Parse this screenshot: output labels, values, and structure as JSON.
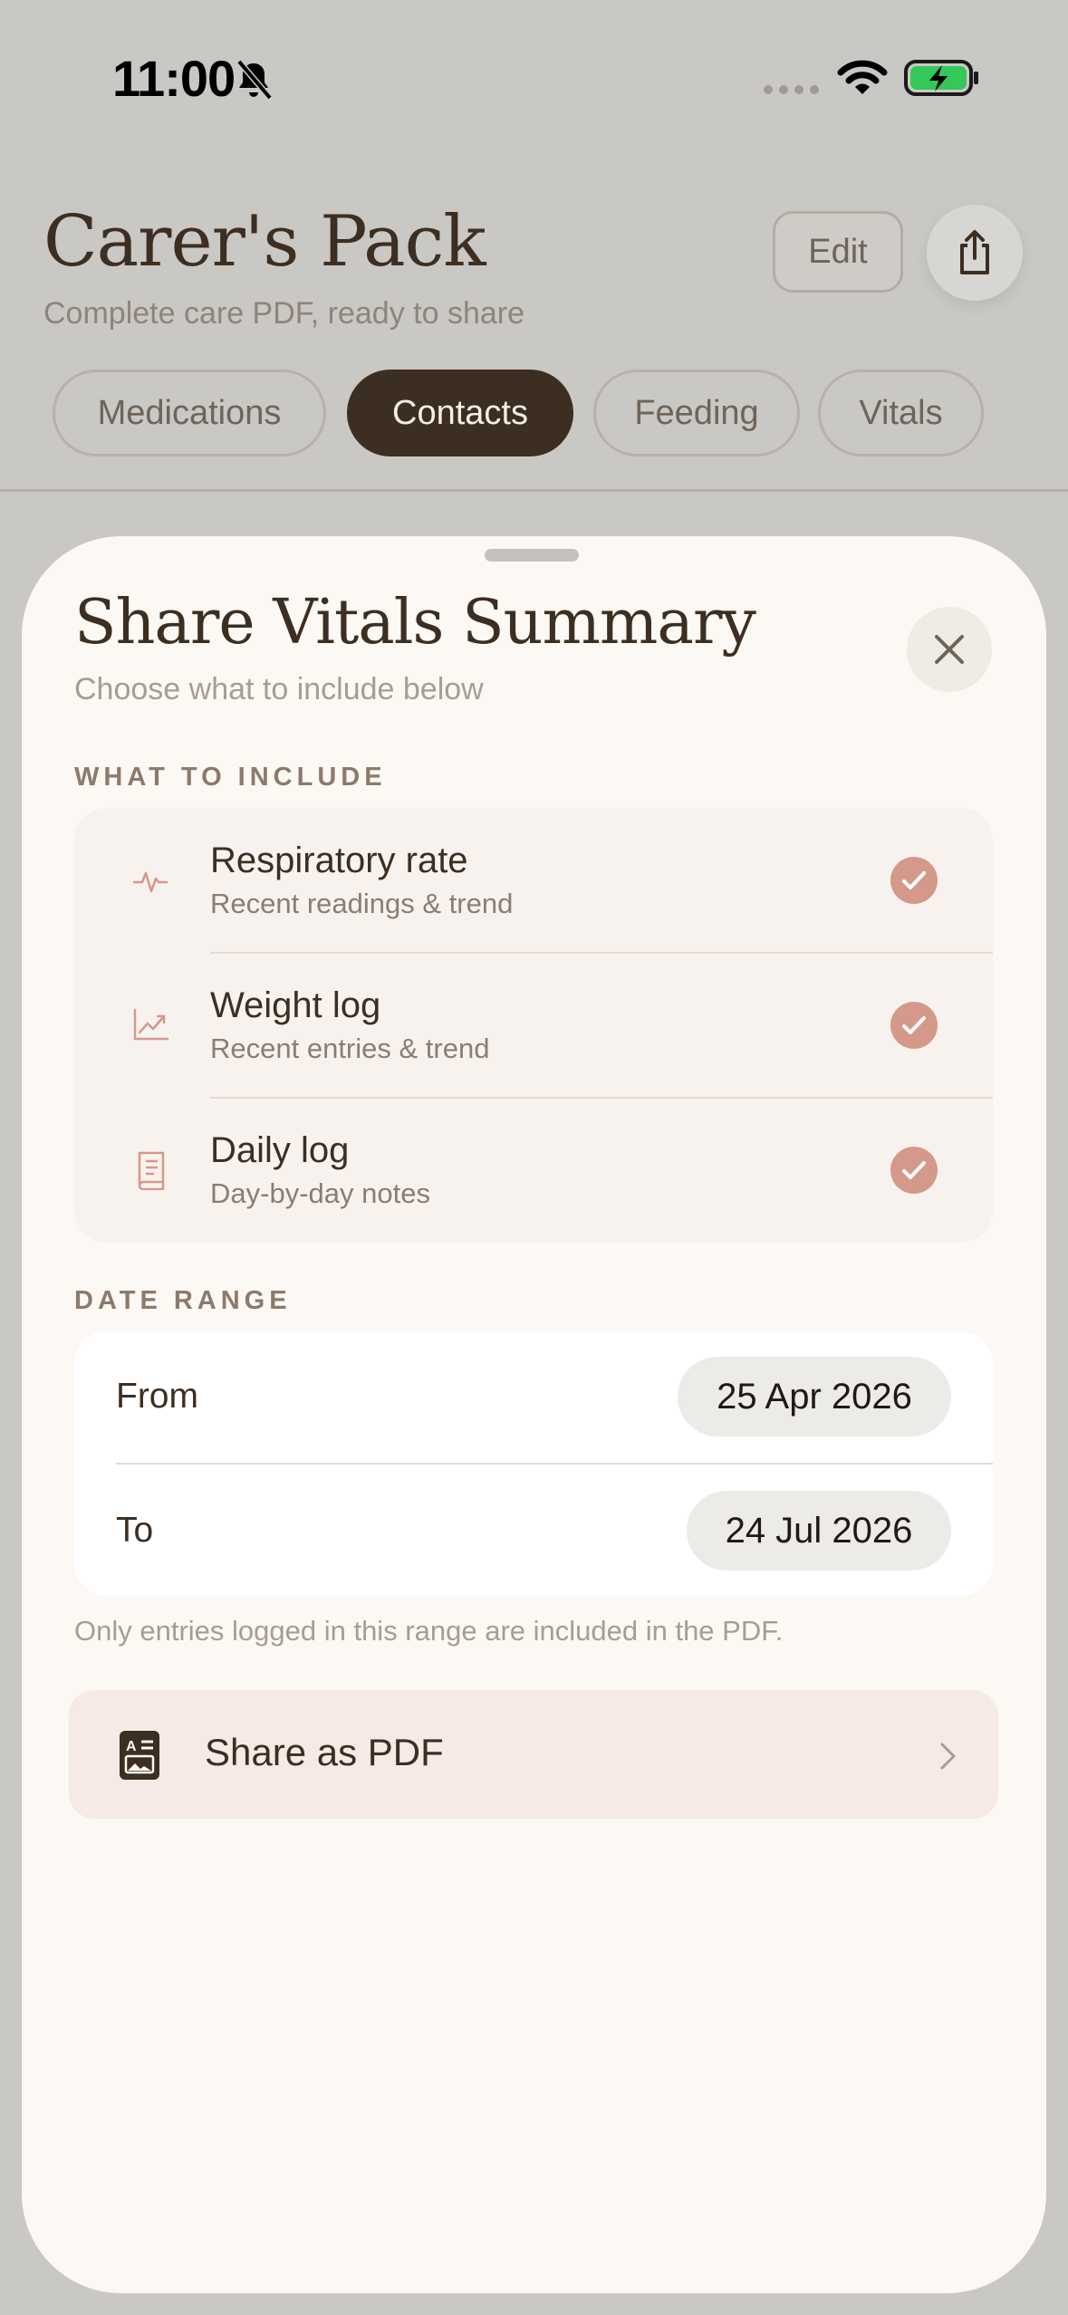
{
  "status_bar": {
    "time": "11:00"
  },
  "header": {
    "title": "Carer's Pack",
    "subtitle": "Complete care PDF, ready to share",
    "edit_label": "Edit"
  },
  "tabs": [
    {
      "label": "Medications",
      "active": false
    },
    {
      "label": "Contacts",
      "active": true
    },
    {
      "label": "Feeding",
      "active": false
    },
    {
      "label": "Vitals",
      "active": false
    }
  ],
  "sheet": {
    "title": "Share Vitals Summary",
    "subtitle": "Choose what to include below",
    "include_label": "WHAT TO INCLUDE",
    "items": [
      {
        "title": "Respiratory rate",
        "subtitle": "Recent readings & trend",
        "icon": "pulse-icon",
        "checked": true
      },
      {
        "title": "Weight log",
        "subtitle": "Recent entries & trend",
        "icon": "chart-trend-icon",
        "checked": true
      },
      {
        "title": "Daily log",
        "subtitle": "Day-by-day notes",
        "icon": "book-icon",
        "checked": true
      }
    ],
    "date_range_label": "DATE RANGE",
    "from_label": "From",
    "from_value": "25 Apr 2026",
    "to_label": "To",
    "to_value": "24 Jul 2026",
    "note": "Only entries logged in this range are included in the PDF.",
    "share_label": "Share as PDF"
  },
  "colors": {
    "accent": "#d4998a",
    "dark": "#3d2e22",
    "sheet_bg": "#fcf8f3",
    "dim_bg": "#cac8c4"
  }
}
